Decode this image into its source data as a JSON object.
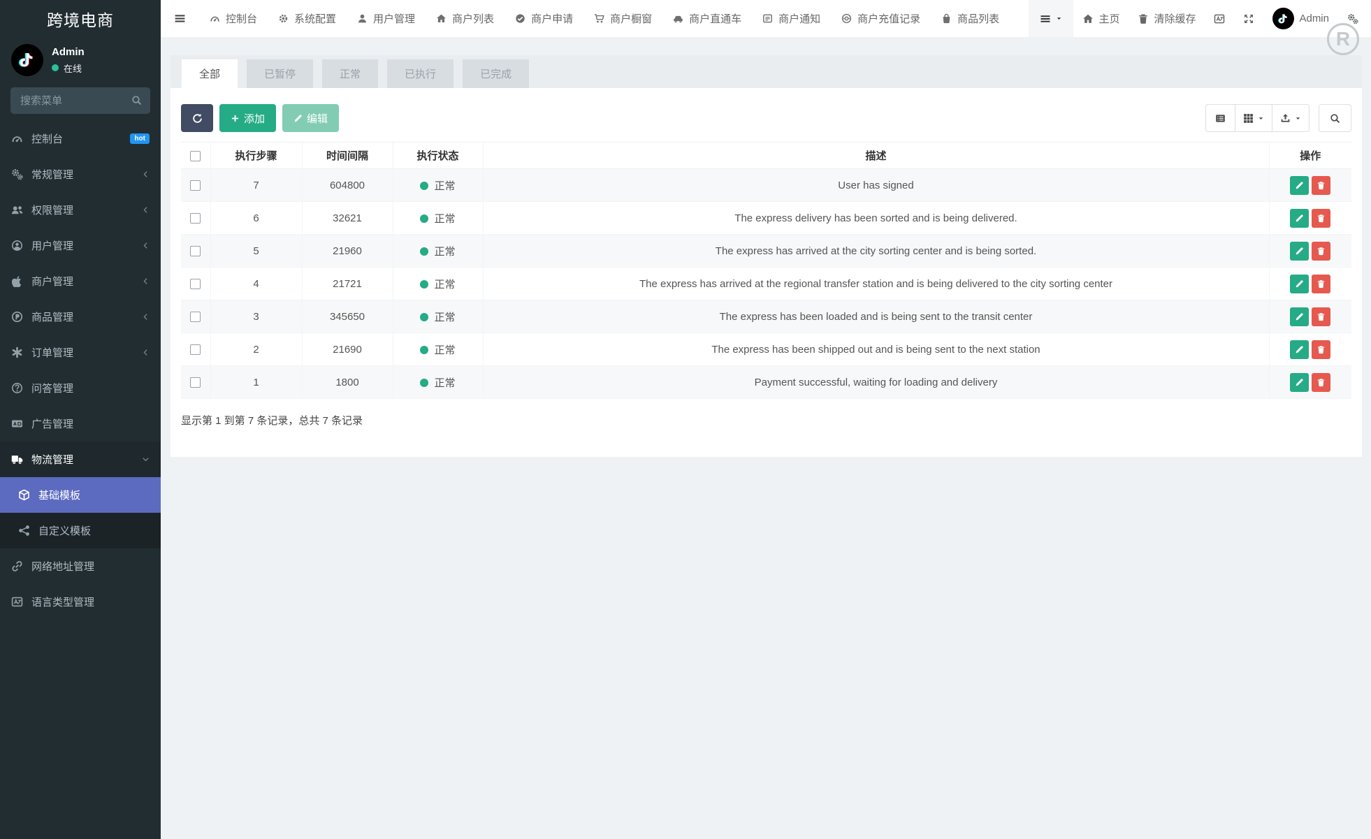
{
  "app": {
    "title": "跨境电商",
    "user": {
      "name": "Admin",
      "status": "在线"
    }
  },
  "watermark": "R",
  "sidebar": {
    "search_placeholder": "搜索菜单",
    "items": [
      {
        "key": "console",
        "label": "控制台",
        "icon": "gauge",
        "badge": "hot"
      },
      {
        "key": "general",
        "label": "常规管理",
        "icon": "gears",
        "arrow": "left"
      },
      {
        "key": "permission",
        "label": "权限管理",
        "icon": "users",
        "arrow": "left"
      },
      {
        "key": "user",
        "label": "用户管理",
        "icon": "user-circle",
        "arrow": "left"
      },
      {
        "key": "merchant",
        "label": "商户管理",
        "icon": "apple",
        "arrow": "left"
      },
      {
        "key": "product",
        "label": "商品管理",
        "icon": "p-circle",
        "arrow": "left"
      },
      {
        "key": "order",
        "label": "订单管理",
        "icon": "order",
        "arrow": "left"
      },
      {
        "key": "qa",
        "label": "问答管理",
        "icon": "question-circle"
      },
      {
        "key": "ad",
        "label": "广告管理",
        "icon": "ad"
      },
      {
        "key": "logistics",
        "label": "物流管理",
        "icon": "truck",
        "arrow": "down",
        "expanded": true
      },
      {
        "key": "base-template",
        "label": "基础模板",
        "icon": "cube",
        "child": true,
        "active": true
      },
      {
        "key": "custom-template",
        "label": "自定义模板",
        "icon": "share",
        "child": true
      },
      {
        "key": "url-manage",
        "label": "网络地址管理",
        "icon": "link"
      },
      {
        "key": "language-manage",
        "label": "语言类型管理",
        "icon": "language"
      }
    ]
  },
  "topnav": {
    "items": [
      {
        "key": "console",
        "label": "控制台",
        "icon": "gauge"
      },
      {
        "key": "system-config",
        "label": "系统配置",
        "icon": "gear"
      },
      {
        "key": "user-manage",
        "label": "用户管理",
        "icon": "user"
      },
      {
        "key": "merchant-list",
        "label": "商户列表",
        "icon": "home"
      },
      {
        "key": "merchant-apply",
        "label": "商户申请",
        "icon": "check-circle"
      },
      {
        "key": "merchant-window",
        "label": "商户橱窗",
        "icon": "cart"
      },
      {
        "key": "merchant-express",
        "label": "商户直通车",
        "icon": "car"
      },
      {
        "key": "merchant-notice",
        "label": "商户通知",
        "icon": "notice"
      },
      {
        "key": "merchant-recharge",
        "label": "商户充值记录",
        "icon": "recharge"
      },
      {
        "key": "product-list",
        "label": "商品列表",
        "icon": "bag"
      }
    ],
    "right": {
      "home_label": "主页",
      "clear_cache_label": "清除缓存",
      "user_name": "Admin"
    }
  },
  "tabs": [
    {
      "key": "all",
      "label": "全部",
      "active": true
    },
    {
      "key": "paused",
      "label": "已暂停"
    },
    {
      "key": "normal",
      "label": "正常"
    },
    {
      "key": "executed",
      "label": "已执行"
    },
    {
      "key": "completed",
      "label": "已完成"
    }
  ],
  "toolbar": {
    "add_label": "添加",
    "edit_label": "编辑"
  },
  "table": {
    "columns": [
      "执行步骤",
      "时间间隔",
      "执行状态",
      "描述",
      "操作"
    ],
    "rows": [
      {
        "step": "7",
        "interval": "604800",
        "status": "正常",
        "desc": "User has signed"
      },
      {
        "step": "6",
        "interval": "32621",
        "status": "正常",
        "desc": "The express delivery has been sorted and is being delivered."
      },
      {
        "step": "5",
        "interval": "21960",
        "status": "正常",
        "desc": "The express has arrived at the city sorting center and is being sorted."
      },
      {
        "step": "4",
        "interval": "21721",
        "status": "正常",
        "desc": "The express has arrived at the regional transfer station and is being delivered to the city sorting center"
      },
      {
        "step": "3",
        "interval": "345650",
        "status": "正常",
        "desc": "The express has been loaded and is being sent to the transit center"
      },
      {
        "step": "2",
        "interval": "21690",
        "status": "正常",
        "desc": "The express has been shipped out and is being sent to the next station"
      },
      {
        "step": "1",
        "interval": "1800",
        "status": "正常",
        "desc": "Payment successful, waiting for loading and delivery"
      }
    ],
    "footer": "显示第 1 到第 7 条记录，总共 7 条记录"
  },
  "colors": {
    "accent_green": "#25ab85",
    "danger_red": "#e6594f",
    "active_indigo": "#5c6bc0",
    "primary_dark": "#414b63",
    "hot_badge_blue": "#2095f2",
    "sidebar_bg": "#222d32",
    "page_bg": "#eef2f5"
  }
}
